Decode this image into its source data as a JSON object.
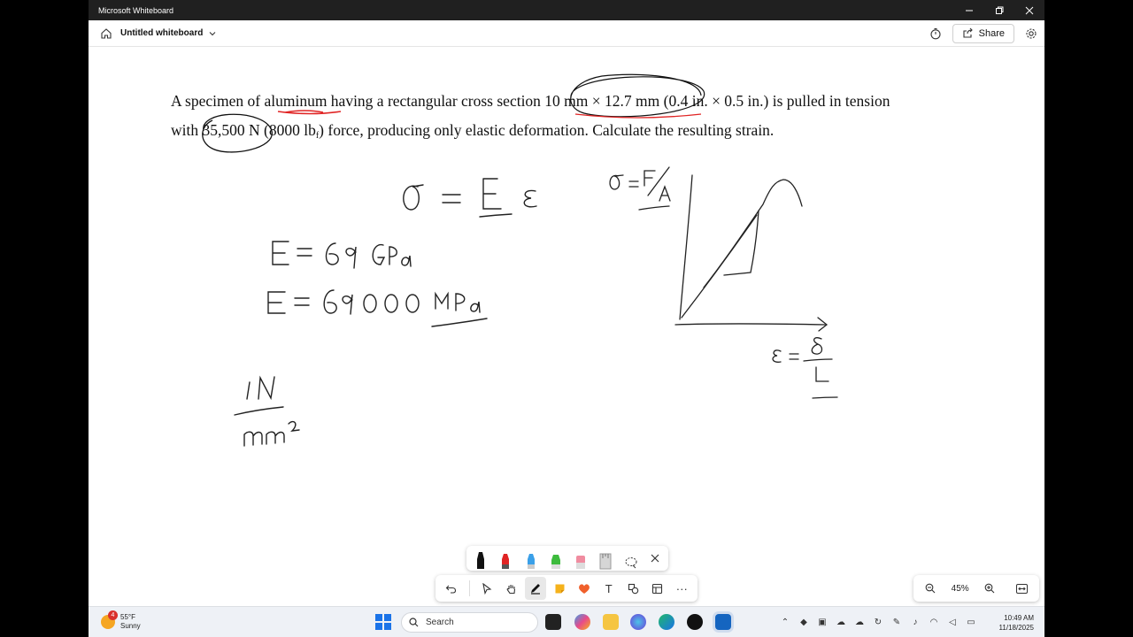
{
  "window": {
    "title": "Microsoft Whiteboard",
    "minimize_icon": "minimize-icon",
    "restore_icon": "restore-icon",
    "close_icon": "close-icon"
  },
  "header": {
    "doc_title": "Untitled whiteboard",
    "share_label": "Share"
  },
  "problem": {
    "line1": "A specimen of aluminum having a rectangular cross section 10 mm × 12.7 mm (0.4 in. × 0.5 in.) is pulled in tension",
    "line2_a": "with 35,500 N (8000 lb",
    "line2_sub": "f",
    "line2_b": ") force, producing only elastic deformation.  Calculate the resulting strain."
  },
  "handwriting": {
    "eq1": "σ = E ε",
    "eq2": "σ = F/A",
    "eq3": "E = 69 GPa",
    "eq4": "E = 69000 MPa",
    "eq5": "1N / mm²",
    "eq6": "ε = δ / L"
  },
  "pen_tray": {
    "colors": [
      "#111111",
      "#e02424",
      "#3aa0e8",
      "#3dbb3d",
      "#f08ca0",
      "#bdbdbd"
    ]
  },
  "toolbar": {
    "tools": [
      "undo",
      "select",
      "hand",
      "pen",
      "note",
      "reaction",
      "text",
      "shapes",
      "template",
      "more"
    ],
    "text_tool_label": "T",
    "more_label": "···"
  },
  "zoom": {
    "value": "45%"
  },
  "taskbar": {
    "weather_temp": "55°F",
    "weather_desc": "Sunny",
    "weather_badge": "4",
    "search_placeholder": "Search",
    "time": "10:49 AM",
    "date": "11/18/2025"
  }
}
